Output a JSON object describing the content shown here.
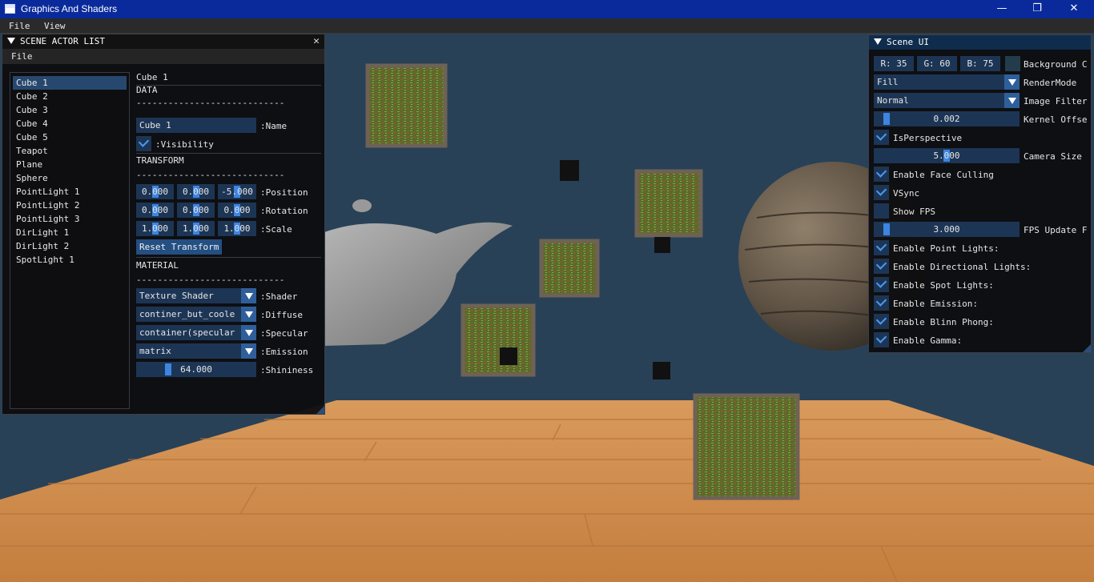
{
  "window": {
    "title": "Graphics And Shaders",
    "minimize": "—",
    "maximize": "❐",
    "close": "✕"
  },
  "menubar": {
    "file": "File",
    "view": "View"
  },
  "actor_window": {
    "title": "SCENE ACTOR LIST",
    "close": "✕",
    "menu_file": "File",
    "actors": [
      "Cube 1",
      "Cube 2",
      "Cube 3",
      "Cube 4",
      "Cube 5",
      "Teapot",
      "Plane",
      "Sphere",
      "PointLight 1",
      "PointLight 2",
      "PointLight 3",
      "DirLight 1",
      "DirLight 2",
      "SpotLight 1"
    ],
    "selected_index": 0,
    "details": {
      "heading": "Cube 1",
      "data_header": "DATA",
      "divider": "----------------------------",
      "name_value": "Cube 1",
      "name_label": ":Name",
      "visibility_checked": true,
      "visibility_label": ":Visibility",
      "transform_header": "TRANSFORM",
      "position": [
        "0.000",
        "0.000",
        "-5.000"
      ],
      "position_label": ":Position",
      "rotation": [
        "0.000",
        "0.000",
        "0.000"
      ],
      "rotation_label": ":Rotation",
      "scale": [
        "1.000",
        "1.000",
        "1.000"
      ],
      "scale_label": ":Scale",
      "reset_transform": "Reset Transform",
      "material_header": "MATERIAL",
      "shader_value": "Texture Shader",
      "shader_label": ":Shader",
      "diffuse_value": "continer_but_coole",
      "diffuse_label": ":Diffuse",
      "specular_value": "container(specular",
      "specular_label": ":Specular",
      "emission_value": "matrix",
      "emission_label": ":Emission",
      "shininess_value": "64.000",
      "shininess_label": ":Shininess"
    }
  },
  "scene_ui": {
    "title": "Scene UI",
    "bg_r": "R: 35",
    "bg_g": "G: 60",
    "bg_b": "B: 75",
    "bg_color": "#233c4b",
    "bg_label": "Background C",
    "render_mode_value": "Fill",
    "render_mode_label": "RenderMode",
    "image_filter_value": "Normal",
    "image_filter_label": "Image Filter",
    "kernel_value": "0.002",
    "kernel_label": "Kernel Offse",
    "is_perspective": {
      "checked": true,
      "label": "IsPerspective"
    },
    "camera_size_value": "5.000",
    "camera_size_label": "Camera Size",
    "face_culling": {
      "checked": true,
      "label": "Enable Face Culling"
    },
    "vsync": {
      "checked": true,
      "label": "VSync"
    },
    "show_fps": {
      "checked": false,
      "label": "Show FPS"
    },
    "fps_update_value": "3.000",
    "fps_update_label": "FPS Update F",
    "point_lights": {
      "checked": true,
      "label": "Enable Point Lights:"
    },
    "dir_lights": {
      "checked": true,
      "label": "Enable Directional Lights:"
    },
    "spot_lights": {
      "checked": true,
      "label": "Enable Spot Lights:"
    },
    "emission": {
      "checked": true,
      "label": "Enable Emission:"
    },
    "blinn_phong": {
      "checked": true,
      "label": "Enable Blinn Phong:"
    },
    "gamma": {
      "checked": true,
      "label": "Enable Gamma:"
    }
  }
}
